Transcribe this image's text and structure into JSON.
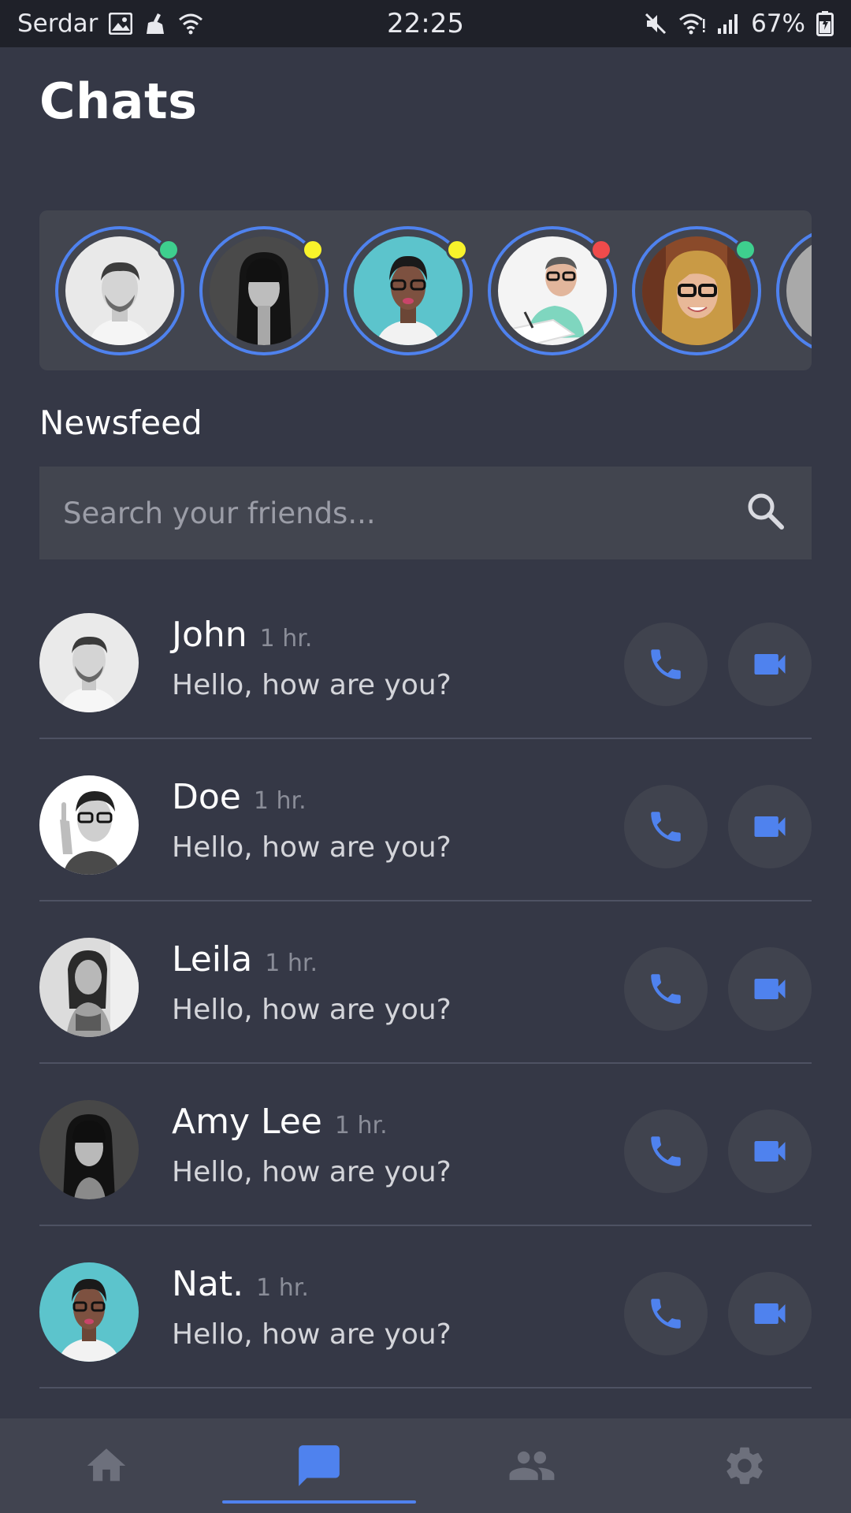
{
  "status_bar": {
    "carrier": "Serdar",
    "time": "22:25",
    "battery": "67%"
  },
  "page": {
    "title": "Chats"
  },
  "stories": [
    {
      "status": "online",
      "status_color": "#3ecf8e",
      "photo": "man-with-beard"
    },
    {
      "status": "away",
      "status_color": "#f8f32b",
      "photo": "woman-with-bangs"
    },
    {
      "status": "away",
      "status_color": "#f8f32b",
      "photo": "woman-with-glasses-teal"
    },
    {
      "status": "busy",
      "status_color": "#f04b4b",
      "photo": "man-with-glasses-writing"
    },
    {
      "status": "online",
      "status_color": "#3ecf8e",
      "photo": "woman-blonde-glasses"
    },
    {
      "status": "unknown",
      "status_color": "",
      "photo": "partial-avatar"
    }
  ],
  "newsfeed": {
    "title": "Newsfeed",
    "search_placeholder": "Search your friends..."
  },
  "chats": [
    {
      "name": "John",
      "time": "1 hr.",
      "message": "Hello, how are you?",
      "photo": "man-with-beard"
    },
    {
      "name": "Doe",
      "time": "1 hr.",
      "message": "Hello, how are you?",
      "photo": "man-with-glasses-pointing"
    },
    {
      "name": "Leila",
      "time": "1 hr.",
      "message": "Hello, how are you?",
      "photo": "woman-portrait-bw"
    },
    {
      "name": "Amy Lee",
      "time": "1 hr.",
      "message": "Hello, how are you?",
      "photo": "woman-with-bangs"
    },
    {
      "name": "Nat.",
      "time": "1 hr.",
      "message": "Hello, how are you?",
      "photo": "woman-with-glasses-teal"
    }
  ],
  "bottom_nav": {
    "items": [
      {
        "icon": "home-icon",
        "active": false
      },
      {
        "icon": "chat-icon",
        "active": true
      },
      {
        "icon": "people-icon",
        "active": false
      },
      {
        "icon": "gear-icon",
        "active": false
      }
    ]
  },
  "colors": {
    "background": "#353846",
    "card": "#42454f",
    "accent": "#4f82ee",
    "status_bar": "#1f2129"
  }
}
